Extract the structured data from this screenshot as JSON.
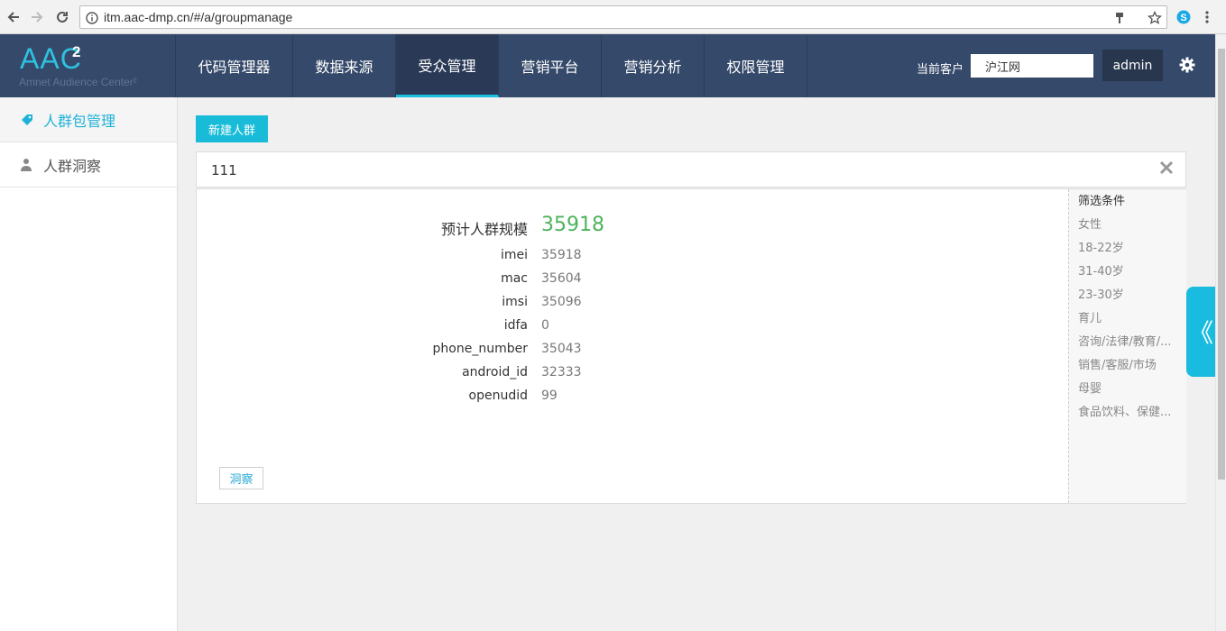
{
  "browser": {
    "url": "itm.aac-dmp.cn/#/a/groupmanage"
  },
  "header": {
    "logo_main": "AAC",
    "logo_sup": "2",
    "logo_sub": "Amnet Audience Center²",
    "nav": [
      {
        "label": "代码管理器",
        "active": false
      },
      {
        "label": "数据来源",
        "active": false
      },
      {
        "label": "受众管理",
        "active": true
      },
      {
        "label": "营销平台",
        "active": false
      },
      {
        "label": "营销分析",
        "active": false
      },
      {
        "label": "权限管理",
        "active": false
      }
    ],
    "client_label": "当前客户",
    "client_value": "沪江网",
    "user": "admin"
  },
  "sidebar": {
    "items": [
      {
        "label": "人群包管理",
        "active": true
      },
      {
        "label": "人群洞察",
        "active": false
      }
    ]
  },
  "main": {
    "new_button": "新建人群",
    "group_name": "111",
    "estimate_label": "预计人群规模",
    "estimate_value": "35918",
    "metrics": [
      {
        "key": "imei",
        "value": "35918"
      },
      {
        "key": "mac",
        "value": "35604"
      },
      {
        "key": "imsi",
        "value": "35096"
      },
      {
        "key": "idfa",
        "value": "0"
      },
      {
        "key": "phone_number",
        "value": "35043"
      },
      {
        "key": "android_id",
        "value": "32333"
      },
      {
        "key": "openudid",
        "value": "99"
      }
    ],
    "insight_button": "洞察",
    "filters": {
      "title": "筛选条件",
      "items": [
        "女性",
        "18-22岁",
        "31-40岁",
        "23-30岁",
        "育儿",
        "咨询/法律/教育/...",
        "销售/客服/市场",
        "母婴",
        "食品饮料、保健..."
      ]
    },
    "toggle_glyph": "《"
  },
  "colors": {
    "header_bg": "#35496a",
    "accent": "#19bcd8",
    "estimate_green": "#4cb35a"
  }
}
